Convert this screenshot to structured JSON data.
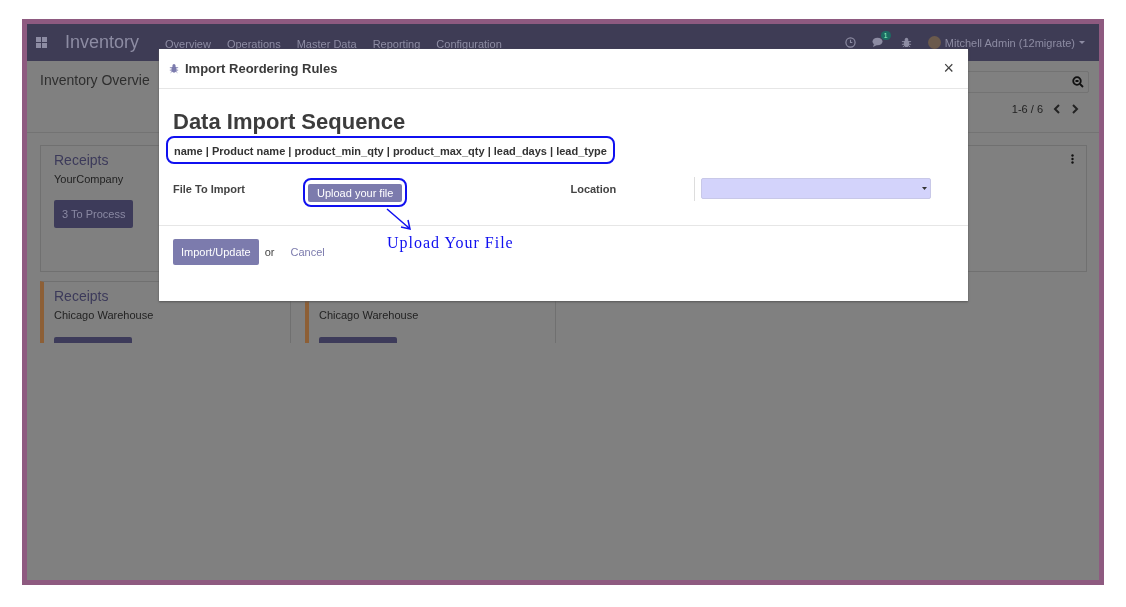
{
  "navbar": {
    "app_name": "Inventory",
    "menu": [
      "Overview",
      "Operations",
      "Master Data",
      "Reporting",
      "Configuration"
    ],
    "chat_badge": "1",
    "user": "Mitchell Admin (12migrate)"
  },
  "control_panel": {
    "title": "Inventory Overvie",
    "pager": "1-6 / 6"
  },
  "cards": [
    {
      "title": "Receipts",
      "subtitle": "YourCompany",
      "button": "3 To Process",
      "accent": false
    },
    {
      "title": "Receipts",
      "subtitle": "Chicago Warehouse",
      "accent": true
    },
    {
      "subtitle": "Chicago Warehouse",
      "accent": true
    }
  ],
  "dialog": {
    "title": "Import Reordering Rules",
    "close": "×",
    "heading": "Data Import Sequence",
    "fields_line": "name | Product name | product_min_qty | product_max_qty | lead_days | lead_type",
    "file_label": "File To Import",
    "upload_button": "Upload your file",
    "location_label": "Location",
    "annotation": "Upload Your File",
    "primary_button": "Import/Update",
    "or_text": "or",
    "cancel": "Cancel"
  }
}
